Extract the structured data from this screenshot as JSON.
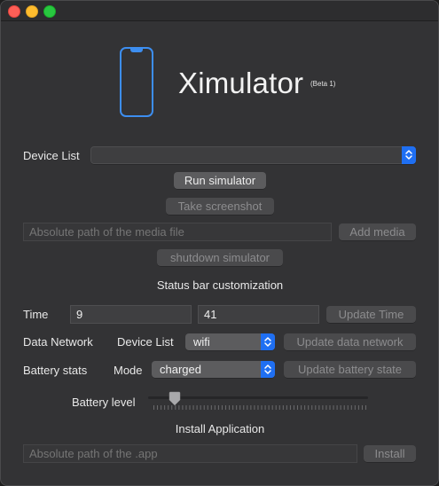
{
  "app": {
    "title": "Ximulator",
    "badge": "(Beta 1)",
    "icon": "iphone-icon",
    "accent_color": "#3d8ef0"
  },
  "device": {
    "label": "Device List",
    "selected": ""
  },
  "buttons": {
    "run_simulator": "Run simulator",
    "take_screenshot": "Take screenshot",
    "add_media": "Add media",
    "shutdown_simulator": "shutdown simulator",
    "update_time": "Update Time",
    "update_data_network": "Update data network",
    "update_battery_state": "Update battery state",
    "install": "Install"
  },
  "media": {
    "placeholder": "Absolute path of the media file"
  },
  "status_bar": {
    "heading": "Status bar customization",
    "time": {
      "label": "Time",
      "hours": "9",
      "minutes": "41"
    },
    "data_network": {
      "label": "Data Network",
      "sub_label": "Device List",
      "selected": "wifi"
    },
    "battery": {
      "label": "Battery stats",
      "mode_label": "Mode",
      "selected": "charged",
      "level_label": "Battery level",
      "level_fraction": 0.1
    }
  },
  "install": {
    "heading": "Install Application",
    "placeholder": "Absolute path of the .app"
  }
}
